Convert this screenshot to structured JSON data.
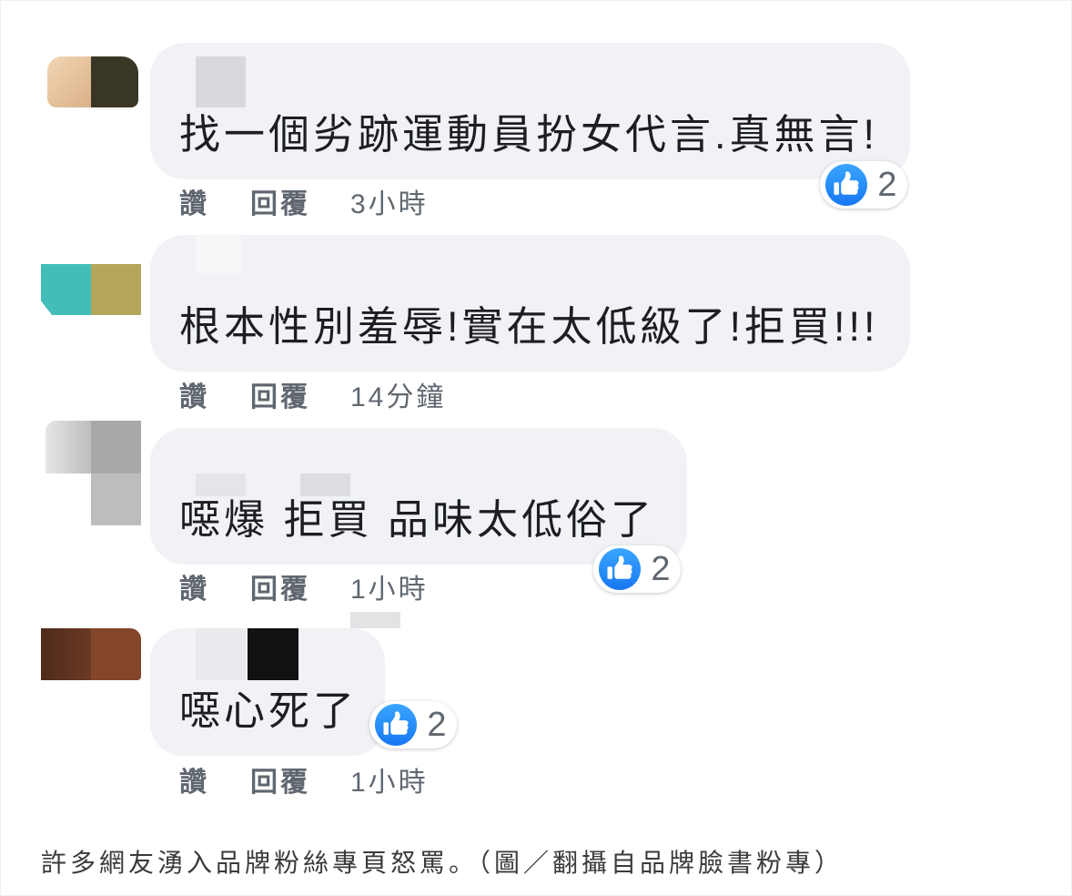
{
  "theme": {
    "bubble_bg": "#f0f2f5",
    "text_color": "#1c1e21",
    "meta_color": "#606770",
    "like_blue": "#1877f2",
    "caption_color": "#3a3b3c"
  },
  "actions": {
    "like_label": "讚",
    "reply_label": "回覆"
  },
  "comments": [
    {
      "text": "找一個劣跡運動員扮女代言.真無言!",
      "time": "3小時",
      "reaction_icon": "like-icon",
      "reaction_count": "2"
    },
    {
      "text": "根本性別羞辱!實在太低級了!拒買!!!",
      "time": "14分鐘"
    },
    {
      "text": "噁爆 拒買 品味太低俗了",
      "time": "1小時",
      "reaction_icon": "like-icon",
      "reaction_count": "2"
    },
    {
      "text": "噁心死了",
      "time": "1小時",
      "reaction_icon": "like-icon",
      "reaction_count": "2"
    }
  ],
  "caption": "許多網友湧入品牌粉絲專頁怒罵。（圖／翻攝自品牌臉書粉專）"
}
